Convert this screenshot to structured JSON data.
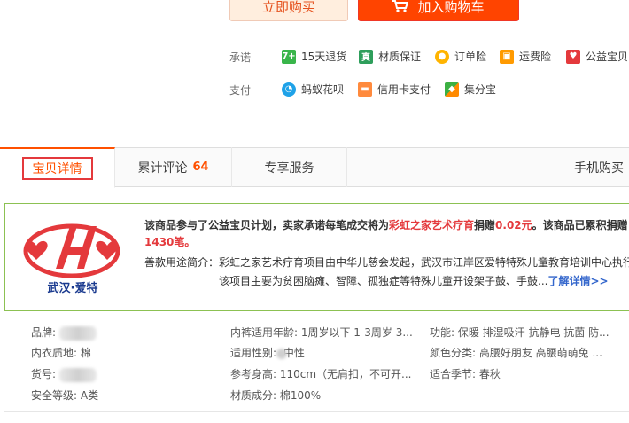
{
  "buttons": {
    "buy_now": "立即购买",
    "add_to_cart": "加入购物车"
  },
  "promise": {
    "label": "承诺",
    "items": [
      {
        "icon": "seven-day-return-icon",
        "label": "15天退货"
      },
      {
        "icon": "quality-guarantee-icon",
        "label": "材质保证"
      },
      {
        "icon": "order-insurance-icon",
        "label": "订单险"
      },
      {
        "icon": "shipping-insurance-icon",
        "label": "运费险"
      },
      {
        "icon": "charity-baby-icon",
        "label": "公益宝贝"
      }
    ]
  },
  "payment": {
    "label": "支付",
    "items": [
      {
        "icon": "huabei-icon",
        "label": "蚂蚁花呗"
      },
      {
        "icon": "credit-card-icon",
        "label": "信用卡支付"
      },
      {
        "icon": "jifenbao-icon",
        "label": "集分宝"
      }
    ]
  },
  "tabs": {
    "detail": "宝贝详情",
    "reviews": "累计评论",
    "reviews_count": "64",
    "service": "专享服务",
    "mobile": "手机购买"
  },
  "charity": {
    "logo_text": "武汉·爱特",
    "line1_prefix": "该商品参与了公益宝贝计划，卖家承诺每笔成交将为",
    "org": "彩虹之家艺术疗育",
    "line1_mid": "捐赠",
    "amount": "0.02元",
    "line1_suffix": "。该商品已累积捐赠",
    "line2": "1430笔。",
    "line3": "善款用途简介：彩虹之家艺术疗育项目由中华儿慈会发起，武汉市江岸区爱特特殊儿童教育培训中心执行。",
    "line4": "该项目主要为贫困脑瘫、智障、孤独症等特殊儿童开设架子鼓、手鼓...",
    "more": "了解详情>>"
  },
  "attributes": {
    "brand": "品牌:",
    "age": "内裤适用年龄: 1周岁以下 1-3周岁 3...",
    "function": "功能: 保暖 排湿吸汗 抗静电 抗菌 防...",
    "material": "内衣质地: 棉",
    "gender_prefix": "适用性别:",
    "gender_value": "中性",
    "color": "颜色分类: 高腰好朋友 高腰萌萌兔 ...",
    "sku": "货号:",
    "height": "参考身高: 110cm（无肩扣，不可开...",
    "season": "适合季节: 春秋",
    "safety": "安全等级: A类",
    "composition": "材质成分: 棉100%"
  },
  "colors": {
    "accent": "#ff5000",
    "cart_bg": "#ff4400",
    "charity_border": "#8cc152",
    "link": "#3366cc"
  }
}
